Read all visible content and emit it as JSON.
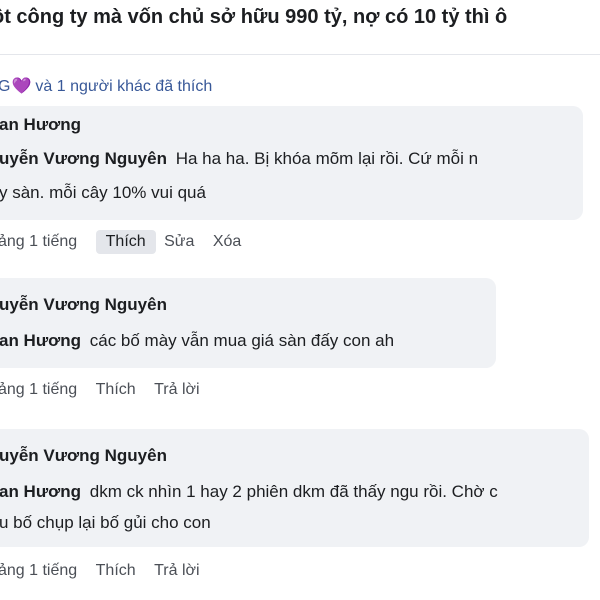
{
  "post": {
    "title": "ột công ty mà vốn chủ sở hữu 990 tỷ, nợ có 10 tỷ thì ô"
  },
  "likes": {
    "prefix": "G",
    "icon": "purple-heart-icon",
    "text": "và 1 người khác đã thích",
    "color": "#385898",
    "heart_color": "#8f3ff0"
  },
  "comments": [
    {
      "author_line": "an Hương",
      "reply_to": "uyễn Vương Nguyên",
      "text_line1": "Ha ha ha. Bị khóa mõm lại rồi. Cứ mỗi n",
      "text_line2": "y sàn. mỗi cây 10% vui quá",
      "time": "ảng 1 tiếng",
      "action1": "Thích",
      "action2": "Sửa",
      "action3": "Xóa"
    },
    {
      "author_line": "uyễn Vương Nguyên",
      "reply_to": "an Hương",
      "text_line1": "các bố mày vẫn mua giá sàn đấy con ah",
      "time": "ảng 1 tiếng",
      "action1": "Thích",
      "action2": "Trả lời"
    },
    {
      "author_line": "uyễn Vương Nguyên",
      "reply_to": "an Hương",
      "text_line1": "dkm ck nhìn 1 hay 2 phiên dkm đã thấy ngu rồi. Chờ c",
      "text_line2": "u bố chụp lại bố gủi cho con",
      "time": "ảng 1 tiếng",
      "action1": "Thích",
      "action2": "Trả lời"
    }
  ],
  "colors": {
    "bubble": "#f0f2f5",
    "text": "#1c1e21",
    "meta": "#4b4f56"
  }
}
